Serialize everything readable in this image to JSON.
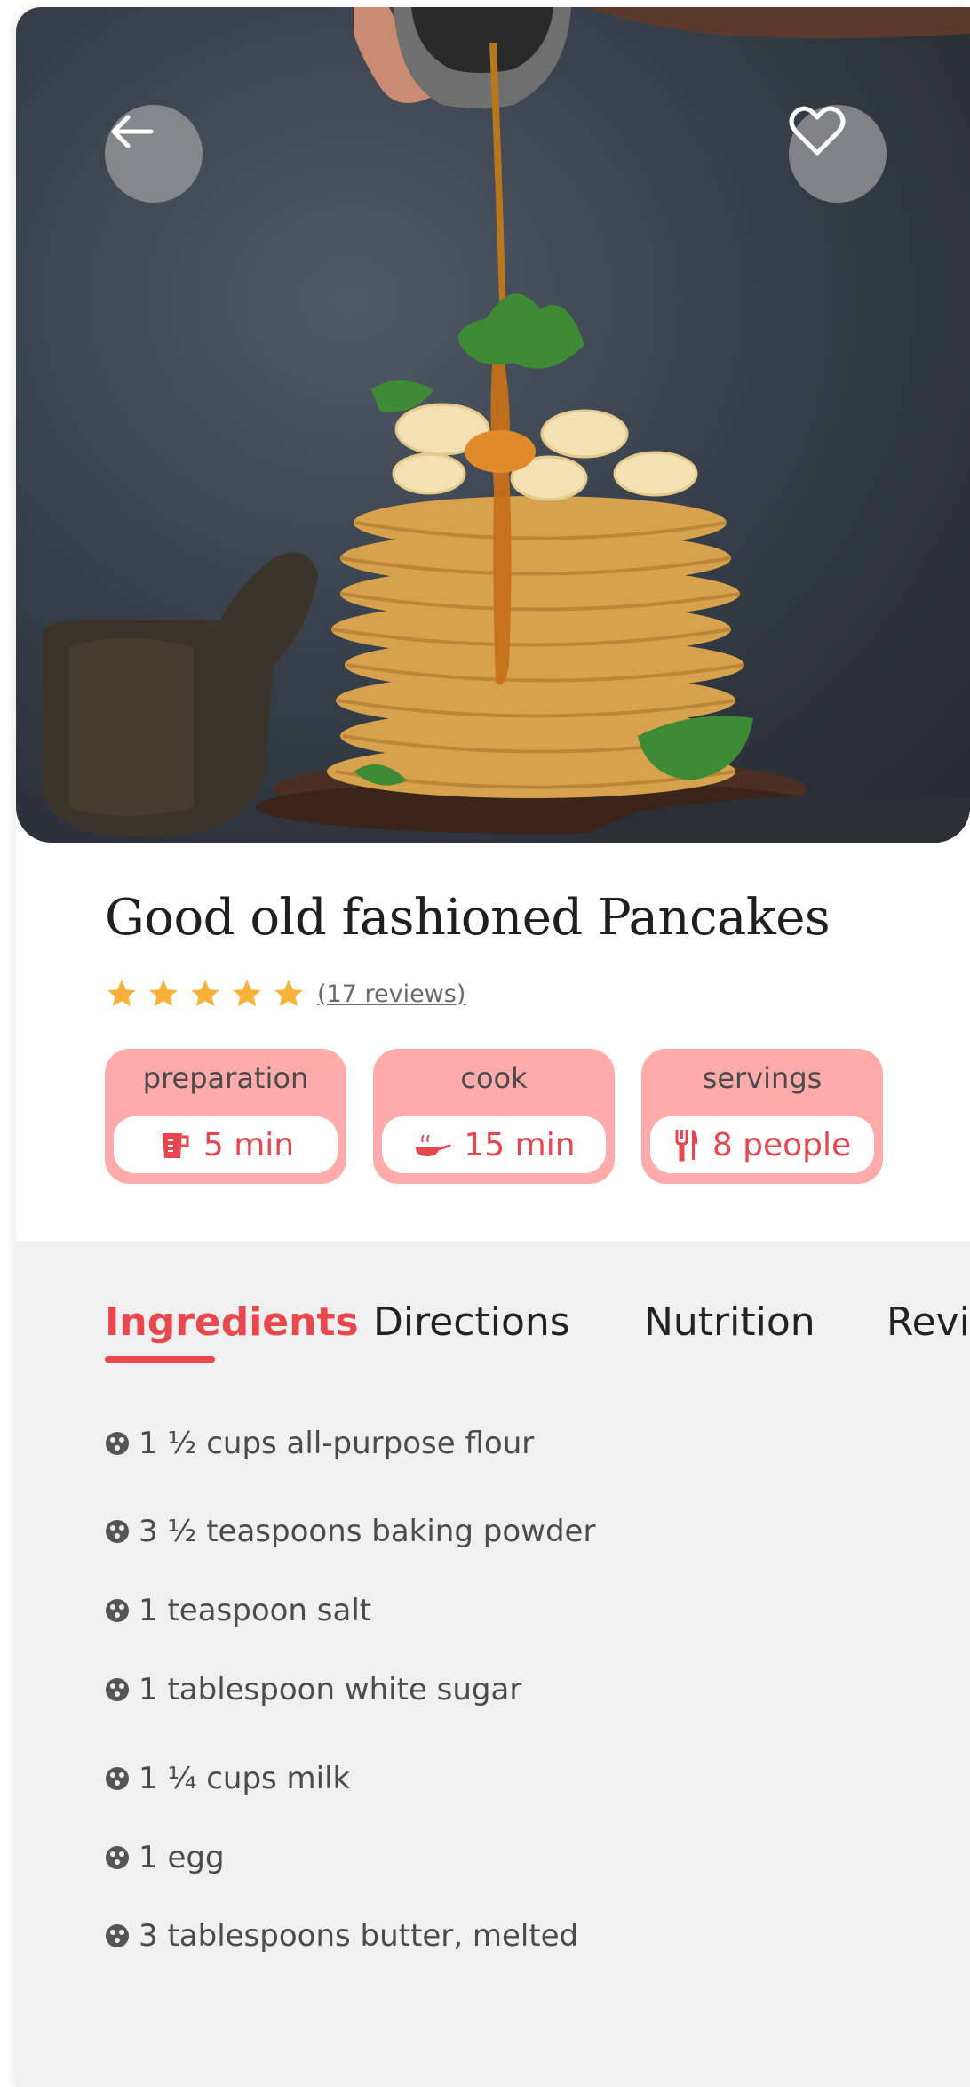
{
  "header": {
    "back_icon": "arrow-left-icon",
    "favorite_icon": "heart-icon"
  },
  "recipe": {
    "title": "Good old fashioned Pancakes",
    "rating": 5,
    "rating_max": 5,
    "reviews_label": "(17 reviews)"
  },
  "info": [
    {
      "label": "preparation",
      "value": "5 min",
      "icon": "measuring-cup-icon"
    },
    {
      "label": "cook",
      "value": "15 min",
      "icon": "cooking-pan-icon"
    },
    {
      "label": "servings",
      "value": "8 people",
      "icon": "utensils-icon"
    }
  ],
  "tabs": [
    {
      "label": "Ingredients",
      "active": true
    },
    {
      "label": "Directions",
      "active": false
    },
    {
      "label": "Nutrition",
      "active": false
    },
    {
      "label": "Reviews",
      "active": false
    }
  ],
  "ingredients": [
    "1 ½ cups all-purpose flour",
    "3 ½ teaspoons baking powder",
    "1 teaspoon salt",
    "1 tablespoon white sugar",
    "1 ¼ cups milk",
    "1 egg",
    "3 tablespoons butter, melted"
  ],
  "colors": {
    "accent": "#e8474d",
    "pill_bg": "#ffabab",
    "panel_bg": "#f0f0f1",
    "star": "#f8b23a"
  }
}
